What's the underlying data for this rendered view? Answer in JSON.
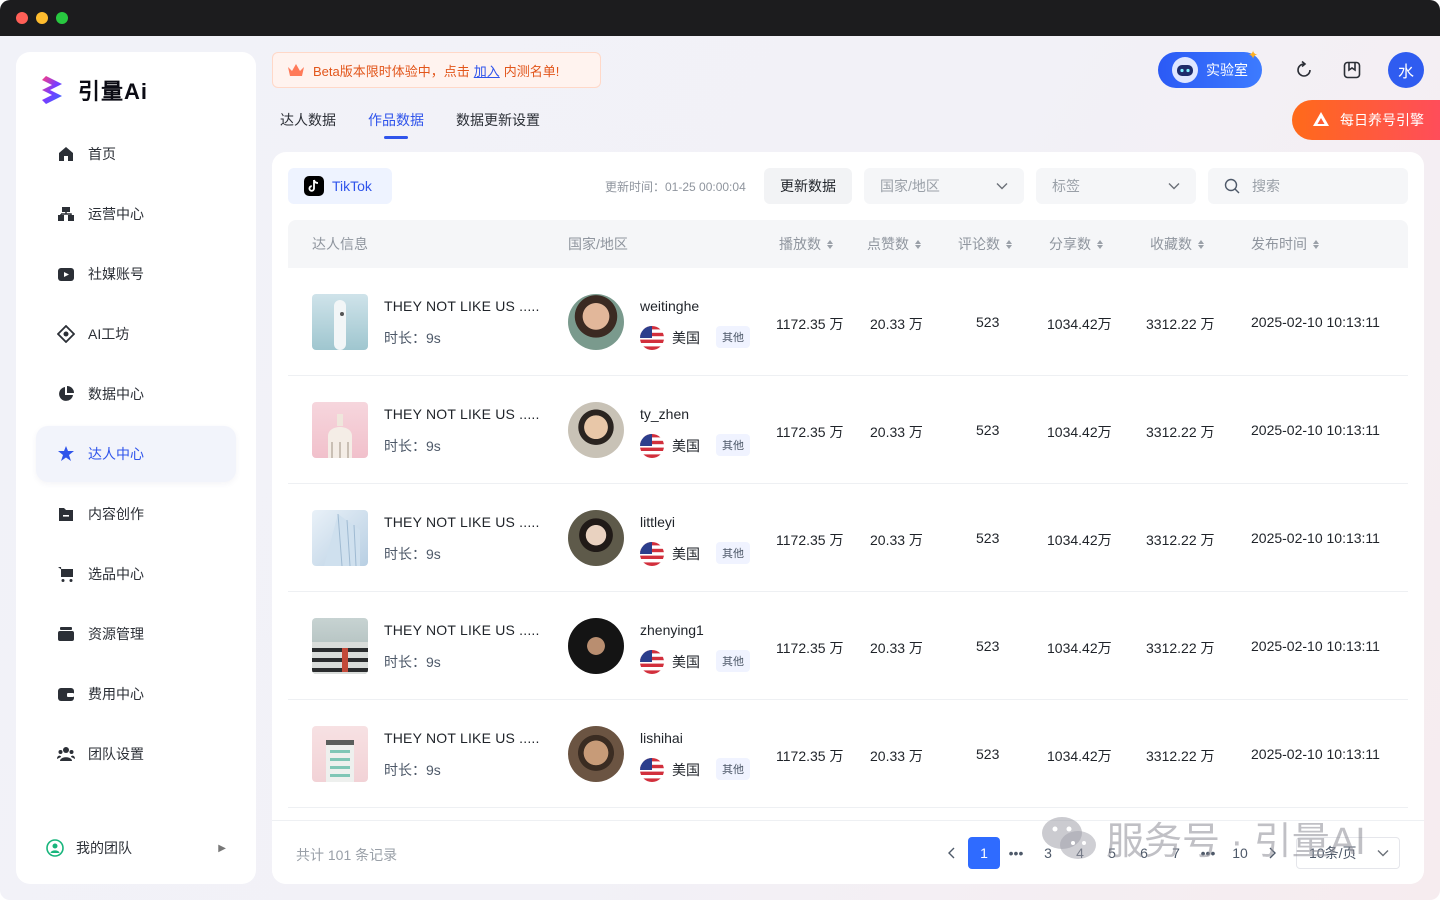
{
  "brand": {
    "name": "引量Ai"
  },
  "sidebar": {
    "items": [
      {
        "label": "首页",
        "icon": "home-icon"
      },
      {
        "label": "运营中心",
        "icon": "operations-icon"
      },
      {
        "label": "社媒账号",
        "icon": "social-account-icon"
      },
      {
        "label": "AI工坊",
        "icon": "ai-workshop-icon"
      },
      {
        "label": "数据中心",
        "icon": "data-center-icon"
      },
      {
        "label": "达人中心",
        "icon": "influencer-icon",
        "active": true
      },
      {
        "label": "内容创作",
        "icon": "content-icon"
      },
      {
        "label": "选品中心",
        "icon": "cart-icon"
      },
      {
        "label": "资源管理",
        "icon": "resource-icon"
      },
      {
        "label": "费用中心",
        "icon": "wallet-icon"
      },
      {
        "label": "团队设置",
        "icon": "team-settings-icon"
      }
    ],
    "team": "我的团队"
  },
  "header": {
    "beta_prefix": "Beta版本限时体验中，点击",
    "beta_link": "加入",
    "beta_suffix": "内测名单!",
    "lab_label": "实验室",
    "avatar_letter": "水",
    "daily_label": "每日养号引擎"
  },
  "tabs": [
    {
      "label": "达人数据"
    },
    {
      "label": "作品数据",
      "active": true
    },
    {
      "label": "数据更新设置"
    }
  ],
  "toolbar": {
    "platform": "TikTok",
    "update_time": "更新时间：01-25 00:00:04",
    "update_button": "更新数据",
    "country_placeholder": "国家/地区",
    "tag_placeholder": "标签",
    "search_placeholder": "搜索"
  },
  "table": {
    "headers": [
      "达人信息",
      "国家/地区",
      "播放数",
      "点赞数",
      "评论数",
      "分享数",
      "收藏数",
      "发布时间"
    ],
    "rows": [
      {
        "title": "THEY NOT LIKE US .....",
        "duration": "时长：9s",
        "username": "weitinghe",
        "country": "美国",
        "tag": "其他",
        "plays": "1172.35 万",
        "likes": "20.33 万",
        "comments": "523",
        "shares": "1034.42万",
        "saves": "3312.22 万",
        "published": "2025-02-10 10:13:11"
      },
      {
        "title": "THEY NOT LIKE US .....",
        "duration": "时长：9s",
        "username": "ty_zhen",
        "country": "美国",
        "tag": "其他",
        "plays": "1172.35 万",
        "likes": "20.33 万",
        "comments": "523",
        "shares": "1034.42万",
        "saves": "3312.22 万",
        "published": "2025-02-10 10:13:11"
      },
      {
        "title": "THEY NOT LIKE US .....",
        "duration": "时长：9s",
        "username": "littleyi",
        "country": "美国",
        "tag": "其他",
        "plays": "1172.35 万",
        "likes": "20.33 万",
        "comments": "523",
        "shares": "1034.42万",
        "saves": "3312.22 万",
        "published": "2025-02-10 10:13:11"
      },
      {
        "title": "THEY NOT LIKE US .....",
        "duration": "时长：9s",
        "username": "zhenying1",
        "country": "美国",
        "tag": "其他",
        "plays": "1172.35 万",
        "likes": "20.33 万",
        "comments": "523",
        "shares": "1034.42万",
        "saves": "3312.22 万",
        "published": "2025-02-10 10:13:11"
      },
      {
        "title": "THEY NOT LIKE US .....",
        "duration": "时长：9s",
        "username": "lishihai",
        "country": "美国",
        "tag": "其他",
        "plays": "1172.35 万",
        "likes": "20.33 万",
        "comments": "523",
        "shares": "1034.42万",
        "saves": "3312.22 万",
        "published": "2025-02-10 10:13:11"
      }
    ]
  },
  "pagination": {
    "total": "共计 101 条记录",
    "pages": [
      "1",
      "3",
      "4",
      "5",
      "6",
      "7",
      "10"
    ],
    "current": "1",
    "page_size": "10条/页"
  },
  "watermark": {
    "text": "服务号 · 引量AI"
  },
  "colors": {
    "accent": "#2f54eb",
    "primary_button": "#2f6bff",
    "daily_gradient_start": "#ff6a1a",
    "daily_gradient_end": "#ff4d5a"
  }
}
